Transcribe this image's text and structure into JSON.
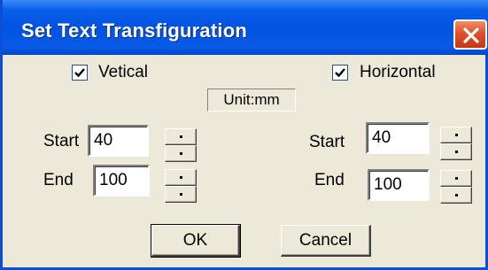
{
  "dialog": {
    "title": "Set Text Transfiguration"
  },
  "options": {
    "vertical": {
      "label": "Vetical",
      "checked": true
    },
    "horizontal": {
      "label": "Horizontal",
      "checked": true
    },
    "unit_label": "Unit:mm"
  },
  "vertical_fields": {
    "start_label": "Start",
    "start_value": "40",
    "end_label": "End",
    "end_value": "100"
  },
  "horizontal_fields": {
    "start_label": "Start",
    "start_value": "40",
    "end_label": "End",
    "end_value": "100"
  },
  "buttons": {
    "ok_label": "OK",
    "cancel_label": "Cancel"
  },
  "icons": {
    "close": "close-x-icon",
    "checkmark": "checkmark-icon",
    "spin_up": "spin-up-icon",
    "spin_down": "spin-down-icon"
  },
  "colors": {
    "titlebar": "#0053e2",
    "close_button": "#e0502a",
    "face": "#ece9d8"
  }
}
